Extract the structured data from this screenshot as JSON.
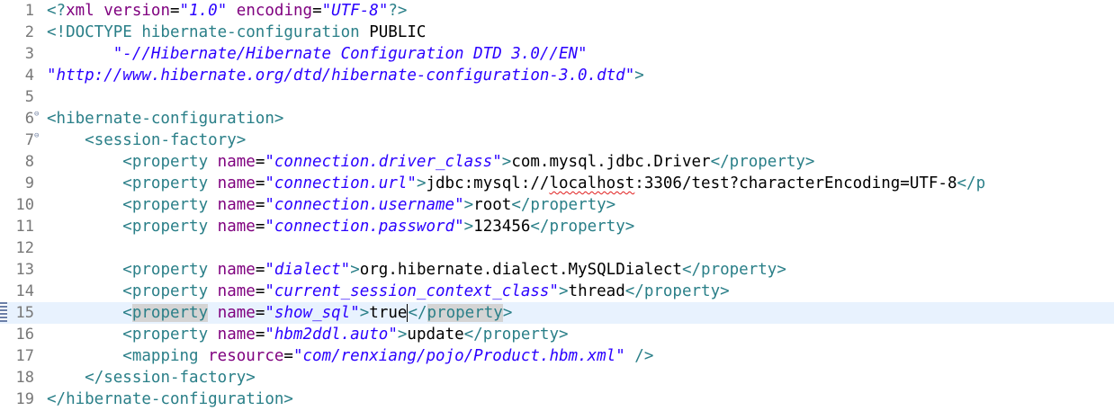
{
  "editor": {
    "active_line": 15,
    "lines": [
      {
        "n": "1",
        "fold": "",
        "segs": [
          [
            "pi",
            "<?"
          ],
          [
            "attr",
            "xml "
          ],
          [
            "attr",
            "version"
          ],
          [
            "plain",
            "="
          ],
          [
            "val",
            "\"1.0\""
          ],
          [
            "plain",
            " "
          ],
          [
            "attr",
            "encoding"
          ],
          [
            "plain",
            "="
          ],
          [
            "val",
            "\"UTF-8\""
          ],
          [
            "pi",
            "?>"
          ]
        ]
      },
      {
        "n": "2",
        "fold": "",
        "segs": [
          [
            "dt",
            "<!DOCTYPE hibernate-configuration "
          ],
          [
            "plain",
            "PUBLIC"
          ]
        ]
      },
      {
        "n": "3",
        "fold": "",
        "segs": [
          [
            "plain",
            "       "
          ],
          [
            "val",
            "\"-//Hibernate/Hibernate Configuration DTD 3.0//EN\""
          ]
        ]
      },
      {
        "n": "4",
        "fold": "",
        "segs": [
          [
            "val",
            "\"http://www.hibernate.org/dtd/hibernate-configuration-3.0.dtd\""
          ],
          [
            "dt",
            ">"
          ]
        ]
      },
      {
        "n": "5",
        "fold": "",
        "segs": []
      },
      {
        "n": "6",
        "fold": "⊖",
        "segs": [
          [
            "tag",
            "<hibernate-configuration>"
          ]
        ]
      },
      {
        "n": "7",
        "fold": "⊖",
        "segs": [
          [
            "plain",
            "    "
          ],
          [
            "tag",
            "<session-factory>"
          ]
        ]
      },
      {
        "n": "8",
        "fold": "",
        "segs": [
          [
            "plain",
            "        "
          ],
          [
            "tag",
            "<property "
          ],
          [
            "attr",
            "name"
          ],
          [
            "plain",
            "="
          ],
          [
            "val",
            "\"connection.driver_class\""
          ],
          [
            "tag",
            ">"
          ],
          [
            "plain",
            "com.mysql.jdbc.Driver"
          ],
          [
            "tag",
            "</property>"
          ]
        ]
      },
      {
        "n": "9",
        "fold": "",
        "segs": [
          [
            "plain",
            "        "
          ],
          [
            "tag",
            "<property "
          ],
          [
            "attr",
            "name"
          ],
          [
            "plain",
            "="
          ],
          [
            "val",
            "\"connection.url\""
          ],
          [
            "tag",
            ">"
          ],
          [
            "plain",
            "jdbc:mysql://"
          ],
          [
            "squiggle",
            "localhost"
          ],
          [
            "plain",
            ":3306/test?characterEncoding=UTF-8"
          ],
          [
            "tag",
            "</p"
          ]
        ]
      },
      {
        "n": "10",
        "fold": "",
        "segs": [
          [
            "plain",
            "        "
          ],
          [
            "tag",
            "<property "
          ],
          [
            "attr",
            "name"
          ],
          [
            "plain",
            "="
          ],
          [
            "val",
            "\"connection.username\""
          ],
          [
            "tag",
            ">"
          ],
          [
            "plain",
            "root"
          ],
          [
            "tag",
            "</property>"
          ]
        ]
      },
      {
        "n": "11",
        "fold": "",
        "segs": [
          [
            "plain",
            "        "
          ],
          [
            "tag",
            "<property "
          ],
          [
            "attr",
            "name"
          ],
          [
            "plain",
            "="
          ],
          [
            "val",
            "\"connection.password\""
          ],
          [
            "tag",
            ">"
          ],
          [
            "plain",
            "123456"
          ],
          [
            "tag",
            "</property>"
          ]
        ]
      },
      {
        "n": "12",
        "fold": "",
        "segs": []
      },
      {
        "n": "13",
        "fold": "",
        "segs": [
          [
            "plain",
            "        "
          ],
          [
            "tag",
            "<property "
          ],
          [
            "attr",
            "name"
          ],
          [
            "plain",
            "="
          ],
          [
            "val",
            "\"dialect\""
          ],
          [
            "tag",
            ">"
          ],
          [
            "plain",
            "org.hibernate.dialect.MySQLDialect"
          ],
          [
            "tag",
            "</property>"
          ]
        ]
      },
      {
        "n": "14",
        "fold": "",
        "segs": [
          [
            "plain",
            "        "
          ],
          [
            "tag",
            "<property "
          ],
          [
            "attr",
            "name"
          ],
          [
            "plain",
            "="
          ],
          [
            "val",
            "\"current_session_context_class\""
          ],
          [
            "tag",
            ">"
          ],
          [
            "plain",
            "thread"
          ],
          [
            "tag",
            "</property>"
          ]
        ]
      },
      {
        "n": "15",
        "fold": "",
        "segs": [
          [
            "plain",
            "        "
          ],
          [
            "tag",
            "<"
          ],
          [
            "hltag",
            "property"
          ],
          [
            "plain",
            " "
          ],
          [
            "attr",
            "name"
          ],
          [
            "plain",
            "="
          ],
          [
            "val",
            "\"show_sql\""
          ],
          [
            "tag",
            ">"
          ],
          [
            "plain",
            "true"
          ],
          [
            "caret",
            ""
          ],
          [
            "tag",
            "</"
          ],
          [
            "hltag",
            "property"
          ],
          [
            "tag",
            ">"
          ]
        ]
      },
      {
        "n": "16",
        "fold": "",
        "segs": [
          [
            "plain",
            "        "
          ],
          [
            "tag",
            "<property "
          ],
          [
            "attr",
            "name"
          ],
          [
            "plain",
            "="
          ],
          [
            "val",
            "\"hbm2ddl.auto\""
          ],
          [
            "tag",
            ">"
          ],
          [
            "plain",
            "update"
          ],
          [
            "tag",
            "</property>"
          ]
        ]
      },
      {
        "n": "17",
        "fold": "",
        "segs": [
          [
            "plain",
            "        "
          ],
          [
            "tag",
            "<mapping "
          ],
          [
            "attr",
            "resource"
          ],
          [
            "plain",
            "="
          ],
          [
            "val",
            "\"com/renxiang/pojo/Product.hbm.xml\""
          ],
          [
            "plain",
            " "
          ],
          [
            "tag",
            "/>"
          ]
        ]
      },
      {
        "n": "18",
        "fold": "",
        "segs": [
          [
            "plain",
            "    "
          ],
          [
            "tag",
            "</session-factory>"
          ]
        ]
      },
      {
        "n": "19",
        "fold": "",
        "segs": [
          [
            "tag",
            "</hibernate-configuration>"
          ]
        ]
      }
    ]
  }
}
